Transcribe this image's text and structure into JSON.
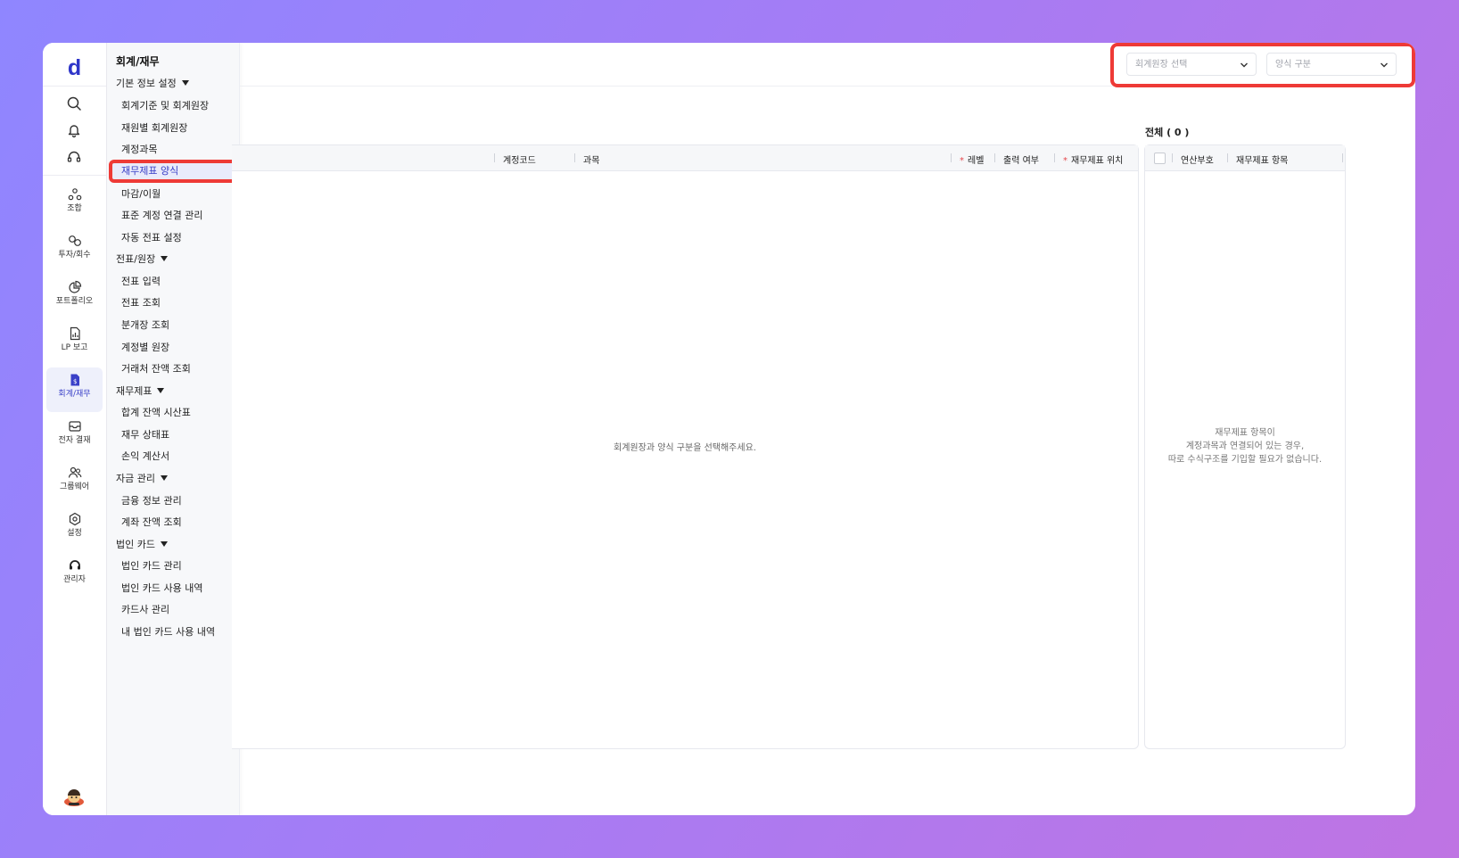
{
  "app": {
    "logo": "d"
  },
  "rail": {
    "items": [
      {
        "key": "union",
        "label": "조합",
        "icon": "union-icon"
      },
      {
        "key": "invest",
        "label": "투자/회수",
        "icon": "invest-icon"
      },
      {
        "key": "portfolio",
        "label": "포트폴리오",
        "icon": "pie-chart-icon"
      },
      {
        "key": "lp",
        "label": "LP 보고",
        "icon": "report-icon"
      },
      {
        "key": "accounting",
        "label": "회계/재무",
        "icon": "accounting-icon",
        "active": true
      },
      {
        "key": "approval",
        "label": "전자 결재",
        "icon": "inbox-icon"
      },
      {
        "key": "groupware",
        "label": "그룹웨어",
        "icon": "people-icon"
      },
      {
        "key": "settings",
        "label": "설정",
        "icon": "gear-icon"
      },
      {
        "key": "admin",
        "label": "관리자",
        "icon": "headset-icon"
      }
    ]
  },
  "menu": {
    "title": "회계/재무",
    "groups": [
      {
        "label": "기본 정보 설정",
        "items": [
          "회계기준 및 회계원장",
          "재원별 회계원장",
          "계정과목",
          "재무제표 양식",
          "마감/이월",
          "표준 계정 연결 관리",
          "자동 전표 설정"
        ]
      },
      {
        "label": "전표/원장",
        "items": [
          "전표 입력",
          "전표 조회",
          "분개장 조회",
          "계정별 원장",
          "거래처 잔액 조회"
        ]
      },
      {
        "label": "재무제표",
        "items": [
          "합계 잔액 시산표",
          "재무 상태표",
          "손익 계산서"
        ]
      },
      {
        "label": "자금 관리",
        "items": [
          "금융 정보 관리",
          "계좌 잔액 조회"
        ]
      },
      {
        "label": "법인 카드",
        "items": [
          "법인 카드 관리",
          "법인 카드 사용 내역",
          "카드사 관리",
          "내 법인 카드 사용 내역"
        ]
      }
    ],
    "selected": "재무제표 양식"
  },
  "filters": {
    "ledger_placeholder": "회계원장 선택",
    "form_type_placeholder": "양식 구분"
  },
  "main_table": {
    "columns": {
      "code": "계정코드",
      "subject": "과목",
      "level": "레벨",
      "print": "출력 여부",
      "position": "재무제표 위치"
    },
    "required_mark": "*",
    "empty_message": "회계원장과 양식 구분을 선택해주세요."
  },
  "side_table": {
    "total_label": "전체 ( 0 )",
    "columns": {
      "seq": "연산부호",
      "item": "재무제표 항목"
    },
    "message_line1": "재무제표 항목이",
    "message_line2": "계정과목과 연결되어 있는 경우,",
    "message_line3": "따로 수식구조를 기입할 필요가 없습니다."
  },
  "colors": {
    "brand": "#2f36c9",
    "highlight": "#ee3a36",
    "active_bg": "#e9ebfb"
  }
}
